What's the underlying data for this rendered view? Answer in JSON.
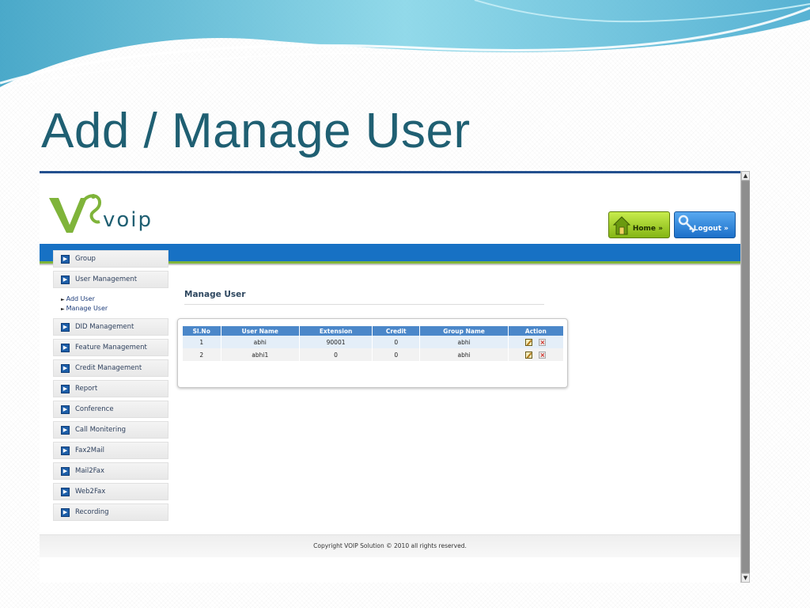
{
  "slide": {
    "title": "Add / Manage User"
  },
  "header": {
    "logo_text": "voip",
    "home_label": "Home",
    "logout_label": "Logout",
    "button_arrow": "»"
  },
  "sidebar": {
    "items": [
      {
        "label": "Group"
      },
      {
        "label": "User Management"
      },
      {
        "label": "DID Management"
      },
      {
        "label": "Feature Management"
      },
      {
        "label": "Credit Management"
      },
      {
        "label": "Report"
      },
      {
        "label": "Conference"
      },
      {
        "label": "Call Monitering"
      },
      {
        "label": "Fax2Mail"
      },
      {
        "label": "Mail2Fax"
      },
      {
        "label": "Web2Fax"
      },
      {
        "label": "Recording"
      }
    ],
    "subitems": [
      {
        "label": "Add User"
      },
      {
        "label": "Manage User"
      }
    ]
  },
  "main": {
    "title": "Manage User",
    "table": {
      "headers": [
        "Sl.No",
        "User Name",
        "Extension",
        "Credit",
        "Group Name",
        "Action"
      ],
      "rows": [
        {
          "slno": "1",
          "username": "abhi",
          "extension": "90001",
          "credit": "0",
          "group": "abhi"
        },
        {
          "slno": "2",
          "username": "abhi1",
          "extension": "0",
          "credit": "0",
          "group": "abhi"
        }
      ]
    }
  },
  "footer": {
    "text": "Copyright VOIP Solution © 2010 all rights reserved."
  },
  "colors": {
    "title": "#1f5f72",
    "nav_blue": "#1771c4",
    "accent_green": "#7fb43a",
    "table_header": "#4b87c9"
  },
  "icons": {
    "nav": "chevron-right-icon",
    "home": "house-icon",
    "logout": "keys-icon",
    "edit": "edit-icon",
    "delete": "delete-icon"
  }
}
